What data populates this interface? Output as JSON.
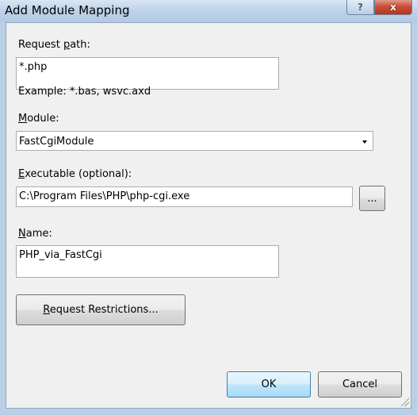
{
  "window": {
    "title": "Add Module Mapping",
    "help_glyph": "?",
    "close_glyph": "x"
  },
  "request_path": {
    "label_pre": "Request ",
    "label_access": "p",
    "label_post": "ath:",
    "value": "*.php",
    "example": "Example: *.bas, wsvc.axd"
  },
  "module": {
    "label_access": "M",
    "label_post": "odule:",
    "selected": "FastCgiModule"
  },
  "executable": {
    "label_access": "E",
    "label_post": "xecutable (optional):",
    "value": "C:\\Program Files\\PHP\\php-cgi.exe",
    "browse_label": "..."
  },
  "name": {
    "label_access": "N",
    "label_post": "ame:",
    "value": "PHP_via_FastCgi"
  },
  "request_restrictions": {
    "label_access": "R",
    "label_post": "equest Restrictions..."
  },
  "buttons": {
    "ok": "OK",
    "cancel": "Cancel"
  }
}
